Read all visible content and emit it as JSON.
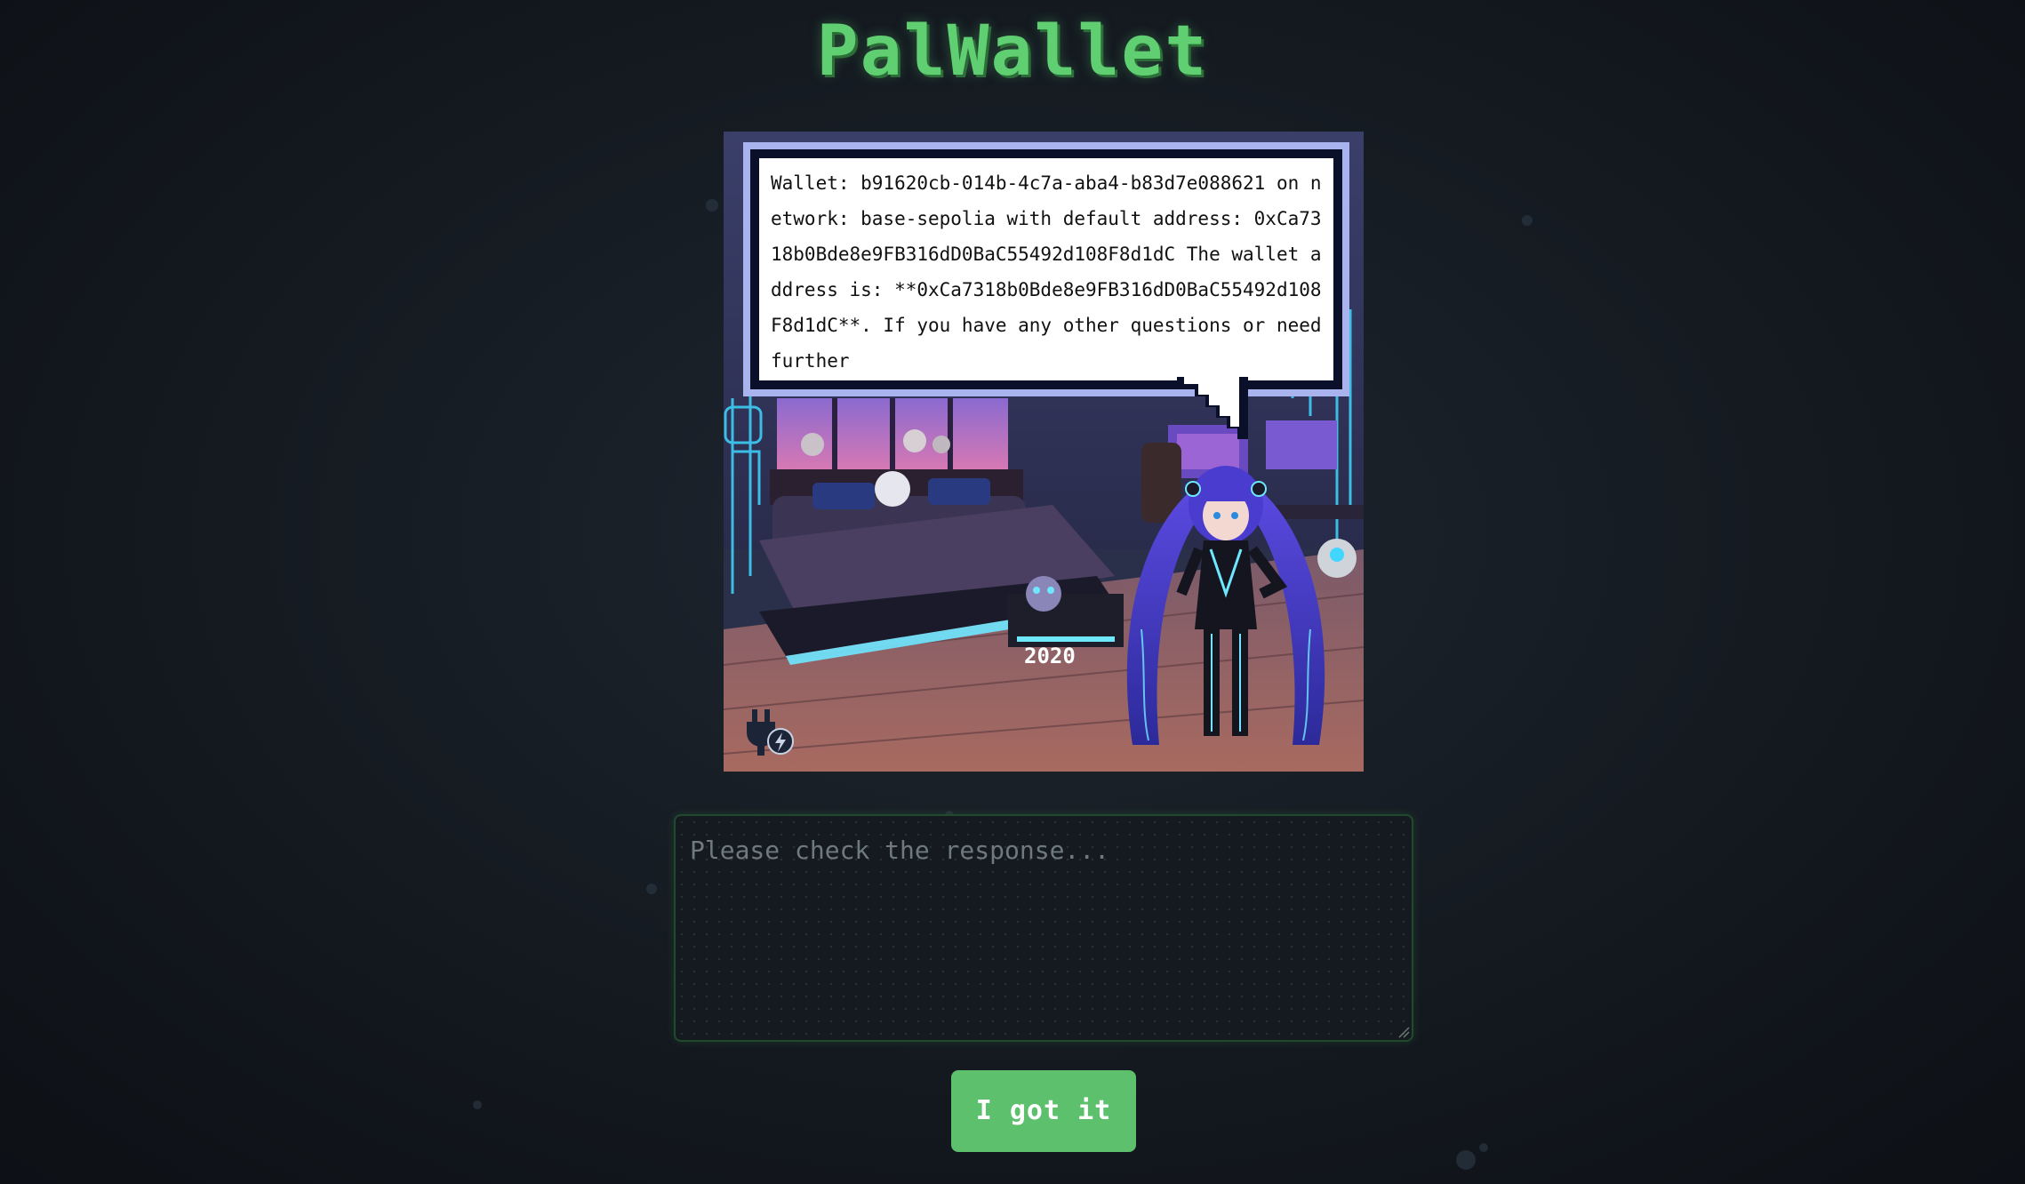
{
  "app": {
    "title": "PalWallet"
  },
  "speech_bubble": {
    "text": "Wallet: b91620cb-014b-4c7a-aba4-b83d7e088621 on network: base-sepolia with default address: 0xCa7318b0Bde8e9FB316dD0BaC55492d108F8d1dC The wallet address is: **0xCa7318b0Bde8e9FB316dD0BaC55492d108F8d1dC**. If you have any other questions or need further"
  },
  "scene": {
    "bed_tag": "2020",
    "badge_icon": "plug-lightning-icon"
  },
  "input": {
    "placeholder": "Please check the response...",
    "value": ""
  },
  "actions": {
    "confirm_label": "I got it"
  },
  "colors": {
    "accent": "#5fcf72",
    "button": "#5cc06c",
    "background": "#161c23",
    "bubble_border": "#0a0f2a",
    "bubble_outline": "#a9b4ef"
  }
}
